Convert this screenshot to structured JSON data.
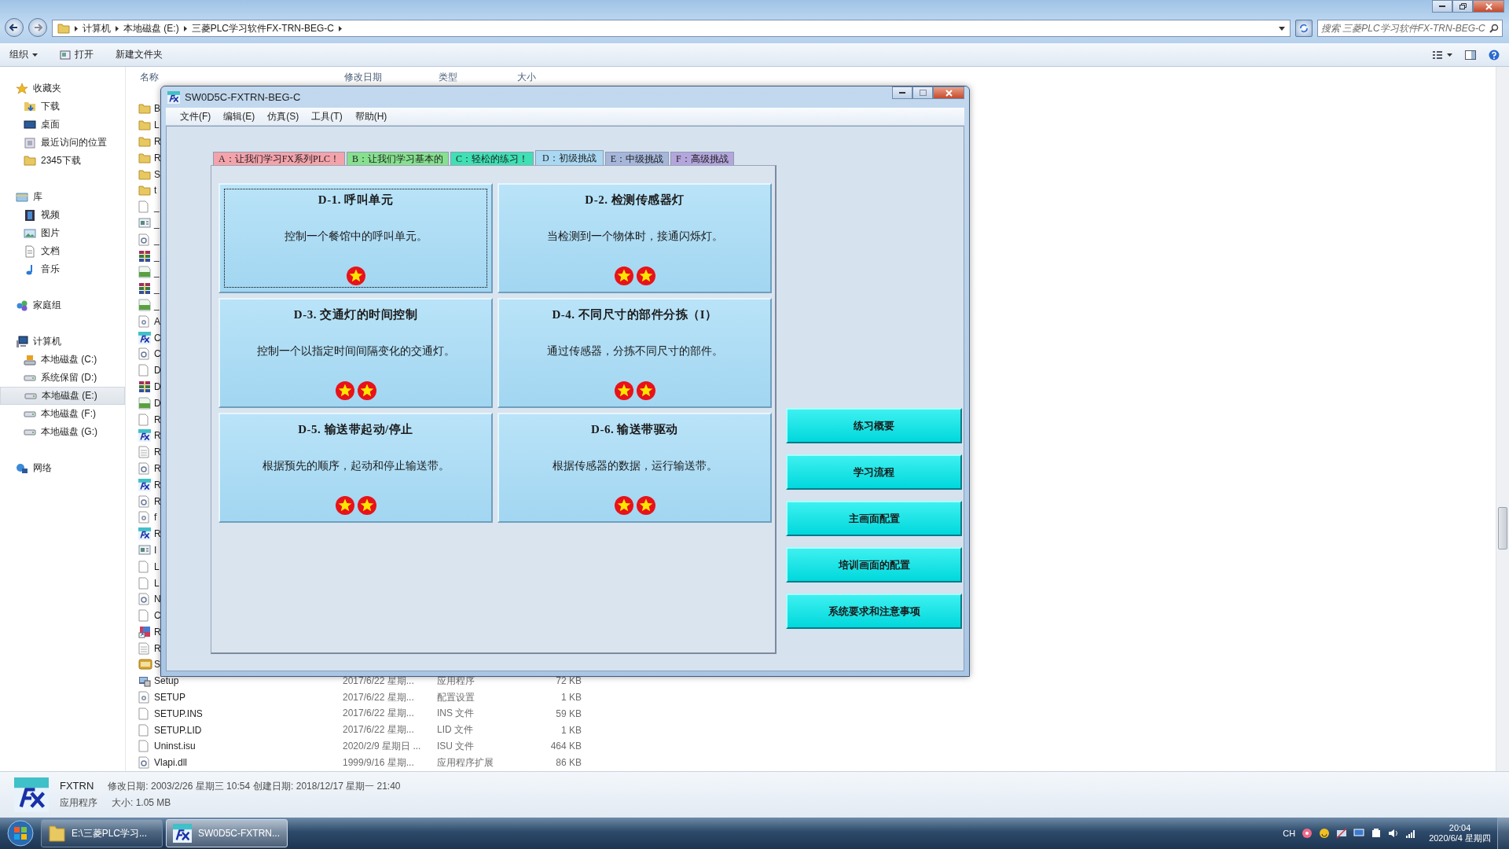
{
  "explorer": {
    "address": {
      "crumbs": [
        "计算机",
        "本地磁盘 (E:)",
        "三菱PLC学习软件FX-TRN-BEG-C"
      ]
    },
    "search": {
      "placeholder": "搜索 三菱PLC学习软件FX-TRN-BEG-C"
    },
    "toolbar": [
      {
        "label": "组织",
        "kind": "menu"
      },
      {
        "label": "打开",
        "kind": "open"
      },
      {
        "label": "新建文件夹",
        "kind": "plain"
      }
    ],
    "sidebar": [
      {
        "label": "收藏夹",
        "kind": "star",
        "selected": false,
        "children": [
          {
            "label": "下载",
            "kind": "download",
            "selected": false
          },
          {
            "label": "桌面",
            "kind": "desktop",
            "selected": false
          },
          {
            "label": "最近访问的位置",
            "kind": "recent",
            "selected": false
          },
          {
            "label": "2345下载",
            "kind": "folder",
            "selected": false
          }
        ]
      },
      {
        "label": "库",
        "kind": "library",
        "selected": false,
        "children": [
          {
            "label": "视频",
            "kind": "video",
            "selected": false
          },
          {
            "label": "图片",
            "kind": "image",
            "selected": false
          },
          {
            "label": "文档",
            "kind": "doc",
            "selected": false
          },
          {
            "label": "音乐",
            "kind": "music",
            "selected": false
          }
        ]
      },
      {
        "label": "家庭组",
        "kind": "homegroup",
        "selected": false
      },
      {
        "label": "计算机",
        "kind": "computer",
        "selected": false,
        "children": [
          {
            "label": "本地磁盘 (C:)",
            "kind": "sysdrive",
            "selected": false
          },
          {
            "label": "系统保留 (D:)",
            "kind": "drive",
            "selected": false
          },
          {
            "label": "本地磁盘 (E:)",
            "kind": "drive",
            "selected": true
          },
          {
            "label": "本地磁盘 (F:)",
            "kind": "drive",
            "selected": false
          },
          {
            "label": "本地磁盘 (G:)",
            "kind": "drive",
            "selected": false
          }
        ]
      },
      {
        "label": "网络",
        "kind": "network",
        "selected": false
      }
    ],
    "columns": [
      "名称",
      "修改日期",
      "类型",
      "大小"
    ],
    "files_behind_window": [
      {
        "name": "B",
        "kind": "folder"
      },
      {
        "name": "L",
        "kind": "folder"
      },
      {
        "name": "R",
        "kind": "folder"
      },
      {
        "name": "R",
        "kind": "folder"
      },
      {
        "name": "S",
        "kind": "folder"
      },
      {
        "name": "t",
        "kind": "folder"
      },
      {
        "name": "_",
        "kind": "blank"
      },
      {
        "name": "_",
        "kind": "form"
      },
      {
        "name": "_",
        "kind": "dll"
      },
      {
        "name": "_",
        "kind": "archive"
      },
      {
        "name": "_",
        "kind": "pic"
      },
      {
        "name": "_",
        "kind": "archive"
      },
      {
        "name": "_",
        "kind": "pic"
      },
      {
        "name": "A",
        "kind": "config"
      },
      {
        "name": "C",
        "kind": "fx"
      },
      {
        "name": "C",
        "kind": "dll"
      },
      {
        "name": "D",
        "kind": "blank"
      },
      {
        "name": "D",
        "kind": "archive"
      },
      {
        "name": "D",
        "kind": "pic"
      },
      {
        "name": "R",
        "kind": "blank"
      },
      {
        "name": "R",
        "kind": "fx"
      },
      {
        "name": "R",
        "kind": "text"
      },
      {
        "name": "R",
        "kind": "dll"
      },
      {
        "name": "R",
        "kind": "fx"
      },
      {
        "name": "R",
        "kind": "dll"
      },
      {
        "name": "f",
        "kind": "config"
      },
      {
        "name": "R",
        "kind": "fx"
      },
      {
        "name": "I",
        "kind": "form"
      },
      {
        "name": "L",
        "kind": "blank"
      },
      {
        "name": "L",
        "kind": "blank"
      },
      {
        "name": "N",
        "kind": "dll"
      },
      {
        "name": "C",
        "kind": "blank"
      },
      {
        "name": "R",
        "kind": "shortcut"
      },
      {
        "name": "R",
        "kind": "text"
      },
      {
        "name": "S",
        "kind": "bmp"
      }
    ],
    "files": [
      {
        "name": "Setup",
        "kind": "setup",
        "date": "2017/6/22 星期...",
        "type": "应用程序",
        "size": "72 KB"
      },
      {
        "name": "SETUP",
        "kind": "config",
        "date": "2017/6/22 星期...",
        "type": "配置设置",
        "size": "1 KB"
      },
      {
        "name": "SETUP.INS",
        "kind": "blank",
        "date": "2017/6/22 星期...",
        "type": "INS 文件",
        "size": "59 KB"
      },
      {
        "name": "SETUP.LID",
        "kind": "blank",
        "date": "2017/6/22 星期...",
        "type": "LID 文件",
        "size": "1 KB"
      },
      {
        "name": "Uninst.isu",
        "kind": "blank",
        "date": "2020/2/9 星期日 ...",
        "type": "ISU 文件",
        "size": "464 KB"
      },
      {
        "name": "Vlapi.dll",
        "kind": "dll",
        "date": "1999/9/16 星期...",
        "type": "应用程序扩展",
        "size": "86 KB"
      }
    ],
    "details": {
      "name": "FXTRN",
      "kind": "应用程序",
      "modified": "修改日期: 2003/2/26 星期三 10:54",
      "created": "创建日期: 2018/12/17 星期一 21:40",
      "size": "大小: 1.05 MB"
    }
  },
  "dialog": {
    "title": "SW0D5C-FXTRN-BEG-C",
    "menu": [
      "文件(F)",
      "编辑(E)",
      "仿真(S)",
      "工具(T)",
      "帮助(H)"
    ],
    "tabs": [
      {
        "label": "A：让我们学习FX系列PLC！",
        "color": "#f4a3ab",
        "selected": false
      },
      {
        "label": "B：让我们学习基本的",
        "color": "#86e08e",
        "selected": false
      },
      {
        "label": "C：轻松的练习！",
        "color": "#3fe0b4",
        "selected": false
      },
      {
        "label": "D：初级挑战",
        "color": "#aad8f2",
        "selected": true
      },
      {
        "label": "E：中级挑战",
        "color": "#a6b6da",
        "selected": false
      },
      {
        "label": "F：高级挑战",
        "color": "#b4a6dc",
        "selected": false
      }
    ],
    "cards": [
      {
        "title": "D-1. 呼叫单元",
        "description": "控制一个餐馆中的呼叫单元。",
        "marks": [
          {
            "kind": "star"
          }
        ],
        "focused": true
      },
      {
        "title": "D-2. 检测传感器灯",
        "description": "当检测到一个物体时，接通闪烁灯。",
        "marks": [
          {
            "kind": "star"
          },
          {
            "kind": "star"
          }
        ],
        "focused": false
      },
      {
        "title": "D-3. 交通灯的时间控制",
        "description": "控制一个以指定时间间隔变化的交通灯。",
        "marks": [
          {
            "kind": "star"
          },
          {
            "kind": "star"
          }
        ],
        "focused": false
      },
      {
        "title": "D-4. 不同尺寸的部件分拣（I）",
        "description": "通过传感器，分拣不同尺寸的部件。",
        "marks": [
          {
            "kind": "star"
          },
          {
            "kind": "star"
          }
        ],
        "focused": false
      },
      {
        "title": "D-5. 输送带起动/停止",
        "description": "根据预先的顺序，起动和停止输送带。",
        "marks": [
          {
            "kind": "star"
          },
          {
            "kind": "star"
          }
        ],
        "focused": false
      },
      {
        "title": "D-6. 输送带驱动",
        "description": "根据传感器的数据，运行输送带。",
        "marks": [
          {
            "kind": "star"
          },
          {
            "kind": "star"
          }
        ],
        "focused": false
      }
    ],
    "buttons": [
      "练习概要",
      "学习流程",
      "主画面配置",
      "培训画面的配置",
      "系统要求和注意事项"
    ]
  },
  "taskbar": {
    "tasks": [
      {
        "label": "E:\\三菱PLC学习...",
        "kind": "folder",
        "selected": false
      },
      {
        "label": "SW0D5C-FXTRN...",
        "kind": "fx",
        "selected": true
      }
    ],
    "language": "CH",
    "time": "20:04",
    "date": "2020/6/4 星期四"
  }
}
